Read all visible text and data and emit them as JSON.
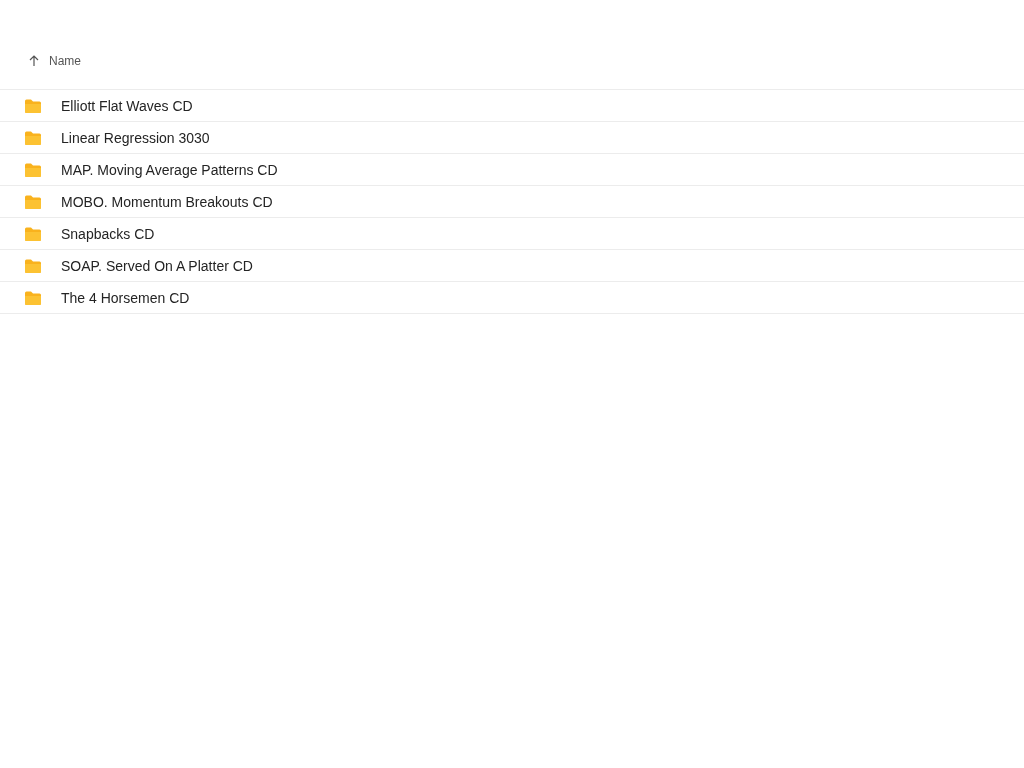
{
  "table": {
    "columns": [
      {
        "label": "Name"
      }
    ],
    "rows": [
      {
        "name": "Elliott Flat Waves CD"
      },
      {
        "name": "Linear Regression 3030"
      },
      {
        "name": "MAP. Moving Average Patterns CD"
      },
      {
        "name": "MOBO. Momentum Breakouts CD"
      },
      {
        "name": "Snapbacks CD"
      },
      {
        "name": "SOAP. Served On A Platter CD"
      },
      {
        "name": "The 4 Horsemen CD"
      }
    ]
  }
}
